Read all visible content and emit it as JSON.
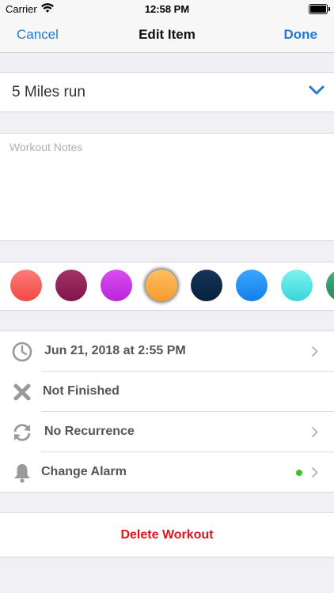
{
  "status_bar": {
    "carrier": "Carrier",
    "time": "12:58 PM"
  },
  "nav": {
    "cancel": "Cancel",
    "title": "Edit Item",
    "done": "Done"
  },
  "item": {
    "title": "5 Miles run"
  },
  "notes": {
    "value": "",
    "placeholder": "Workout Notes"
  },
  "colors": {
    "swatches": [
      {
        "top": "#ff7c79",
        "bottom": "#ef4a45"
      },
      {
        "top": "#a23266",
        "bottom": "#80164a"
      },
      {
        "top": "#dc4cef",
        "bottom": "#b626d8"
      },
      {
        "top": "#ffc062",
        "bottom": "#f59a2c"
      },
      {
        "top": "#163558",
        "bottom": "#07213d"
      },
      {
        "top": "#3aa6ff",
        "bottom": "#137fe8"
      },
      {
        "top": "#7ff1f1",
        "bottom": "#38d6d8"
      },
      {
        "top": "#46b07f",
        "bottom": "#248a5a"
      }
    ],
    "selected_index": 3
  },
  "options": {
    "date": "Jun 21, 2018 at 2:55 PM",
    "status": "Not Finished",
    "recurrence": "No Recurrence",
    "alarm": "Change Alarm"
  },
  "actions": {
    "delete": "Delete Workout"
  },
  "theme": {
    "accent": "#1f7ad6",
    "destructive": "#e0141c",
    "alarm_dot": "#3fbf2c"
  }
}
